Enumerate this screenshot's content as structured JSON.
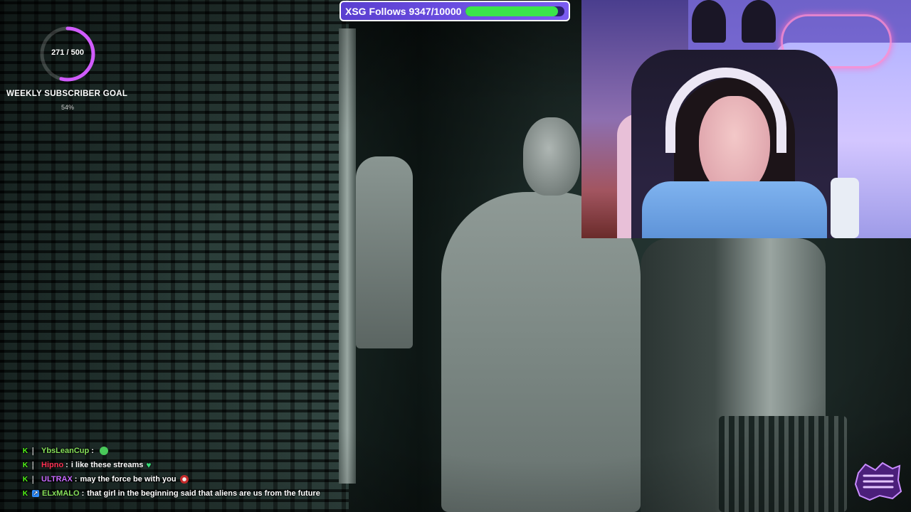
{
  "follow_goal": {
    "label": "XSG Follows 9347/10000",
    "current": 9347,
    "target": 10000,
    "fill_fraction": 0.9347,
    "bar_color": "#3be44b",
    "frame_color": "#6a4ee6"
  },
  "subscriber_goal": {
    "count_text": "271 / 500",
    "title": "WEEKLY SUBSCRIBER GOAL",
    "percent_text": "54%",
    "progress_fraction": 0.54,
    "ring_color": "#d15bff"
  },
  "chat": {
    "messages": [
      {
        "user": "YbsLeanCup",
        "user_color": "#86e05a",
        "text": "",
        "emote": "green-blob-emote",
        "badge": "kick"
      },
      {
        "user": "Hipno",
        "user_color": "#ff3355",
        "text": "i like these streams",
        "emote": "green-heart-emote",
        "badge": "kick"
      },
      {
        "user": "ULTRAX",
        "user_color": "#c86bff",
        "text": "may the force be with you",
        "emote": "stormtrooper-emote",
        "badge": "kick"
      },
      {
        "user": "ELxMALO",
        "user_color": "#86e05a",
        "text": "that girl in the beginning said that aliens are us from the future",
        "emote": "",
        "badge": "kick-blue"
      }
    ]
  },
  "logo": {
    "icon": "streamer-logo-icon",
    "color": "#c98cff"
  }
}
